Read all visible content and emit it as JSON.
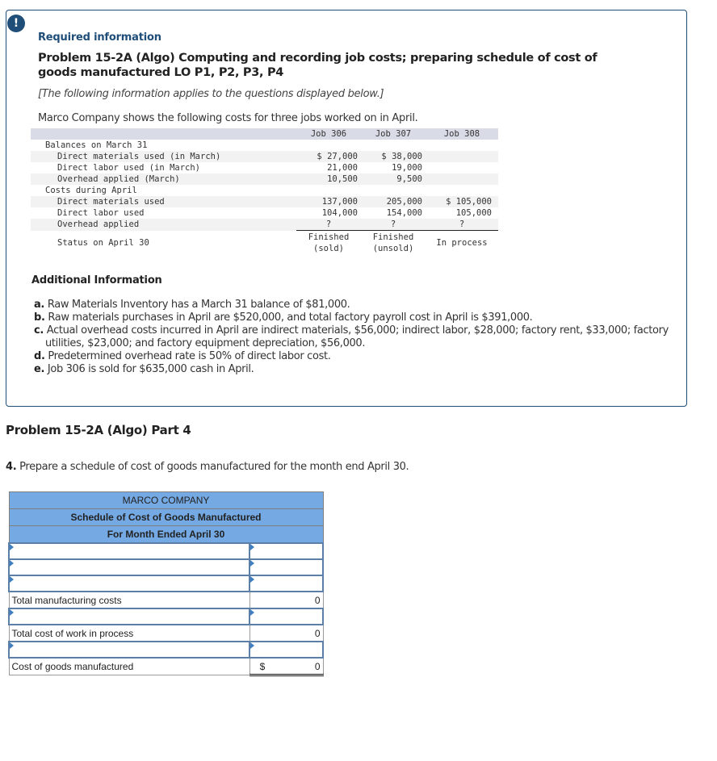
{
  "info_box": {
    "alert_icon": "!",
    "required_info": "Required information",
    "problem_title": "Problem 15-2A (Algo) Computing and recording job costs; preparing schedule of cost of goods manufactured LO P1, P2, P3, P4",
    "note": "[The following information applies to the questions displayed below.]",
    "intro": "Marco Company shows the following costs for three jobs worked on in April."
  },
  "job_table": {
    "columns": [
      "Job 306",
      "Job 307",
      "Job 308"
    ],
    "rows": [
      {
        "label": "Balances on March 31",
        "values": [
          "",
          "",
          ""
        ]
      },
      {
        "label": "Direct materials used (in March)",
        "values": [
          "$ 27,000",
          "$ 38,000",
          ""
        ]
      },
      {
        "label": "Direct labor used (in March)",
        "values": [
          "21,000",
          "19,000",
          ""
        ]
      },
      {
        "label": "Overhead applied (March)",
        "values": [
          "10,500",
          "9,500",
          ""
        ]
      },
      {
        "label": "Costs during April",
        "values": [
          "",
          "",
          ""
        ]
      },
      {
        "label": "Direct materials used",
        "values": [
          "137,000",
          "205,000",
          "$ 105,000"
        ]
      },
      {
        "label": "Direct labor used",
        "values": [
          "104,000",
          "154,000",
          "105,000"
        ]
      },
      {
        "label": "Overhead applied",
        "values": [
          "?",
          "?",
          "?"
        ]
      }
    ],
    "status": {
      "label": "Status on April 30",
      "values": [
        "Finished\n(sold)",
        "Finished\n(unsold)",
        "In process"
      ]
    }
  },
  "additional": {
    "title": "Additional Information",
    "items": [
      {
        "key": "a.",
        "text": "Raw Materials Inventory has a March 31 balance of $81,000."
      },
      {
        "key": "b.",
        "text": "Raw materials purchases in April are $520,000, and total factory payroll cost in April is $391,000."
      },
      {
        "key": "c.",
        "text": "Actual overhead costs incurred in April are indirect materials, $56,000; indirect labor, $28,000; factory rent, $33,000; factory utilities, $23,000; and factory equipment depreciation, $56,000."
      },
      {
        "key": "d.",
        "text": "Predetermined overhead rate is 50% of direct labor cost."
      },
      {
        "key": "e.",
        "text": "Job 306 is sold for $635,000 cash in April."
      }
    ]
  },
  "part": {
    "title": "Problem 15-2A (Algo) Part 4",
    "question_num": "4.",
    "question": "Prepare a schedule of cost of goods manufactured for the month end April 30."
  },
  "schedule": {
    "company": "MARCO COMPANY",
    "title": "Schedule of Cost of Goods Manufactured",
    "period": "For Month Ended April 30",
    "total_manufacturing_label": "Total manufacturing costs",
    "total_manufacturing_value": "0",
    "total_wip_label": "Total cost of work in process",
    "total_wip_value": "0",
    "cogm_label": "Cost of goods manufactured",
    "cogm_currency": "$",
    "cogm_value": "0"
  }
}
